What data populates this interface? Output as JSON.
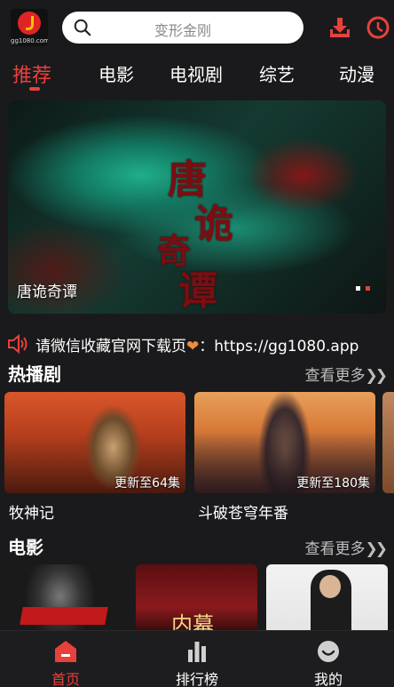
{
  "header": {
    "logo_text": "gg1080.com",
    "search_placeholder": "变形金刚"
  },
  "tabs": [
    {
      "label": "推荐",
      "active": true
    },
    {
      "label": "电影",
      "active": false
    },
    {
      "label": "电视剧",
      "active": false
    },
    {
      "label": "综艺",
      "active": false
    },
    {
      "label": "动漫",
      "active": false
    }
  ],
  "banner": {
    "caption": "唐诡奇谭",
    "artwork_text": [
      "唐",
      "诡",
      "奇",
      "谭"
    ],
    "slide_count": 2,
    "active_slide": 2
  },
  "notice": {
    "text_before_heart": "请微信收藏官网下载页",
    "heart": "❤",
    "text_after_heart": "：https://gg1080.app"
  },
  "hot_series": {
    "title": "热播剧",
    "more_label": "查看更多",
    "items": [
      {
        "title": "牧神记",
        "badge": "更新至64集"
      },
      {
        "title": "斗破苍穹年番",
        "badge": "更新至180集"
      }
    ]
  },
  "movies": {
    "title": "电影",
    "more_label": "查看更多",
    "poster_texts": [
      "",
      "内幕",
      ""
    ]
  },
  "bottom_nav": [
    {
      "label": "首页",
      "icon": "home-icon",
      "active": true
    },
    {
      "label": "排行榜",
      "icon": "ranking-icon",
      "active": false
    },
    {
      "label": "我的",
      "icon": "profile-icon",
      "active": false
    }
  ],
  "colors": {
    "accent": "#e8413b",
    "background": "#1a1a1c",
    "text": "#ffffff",
    "muted": "#bdbdbd"
  }
}
